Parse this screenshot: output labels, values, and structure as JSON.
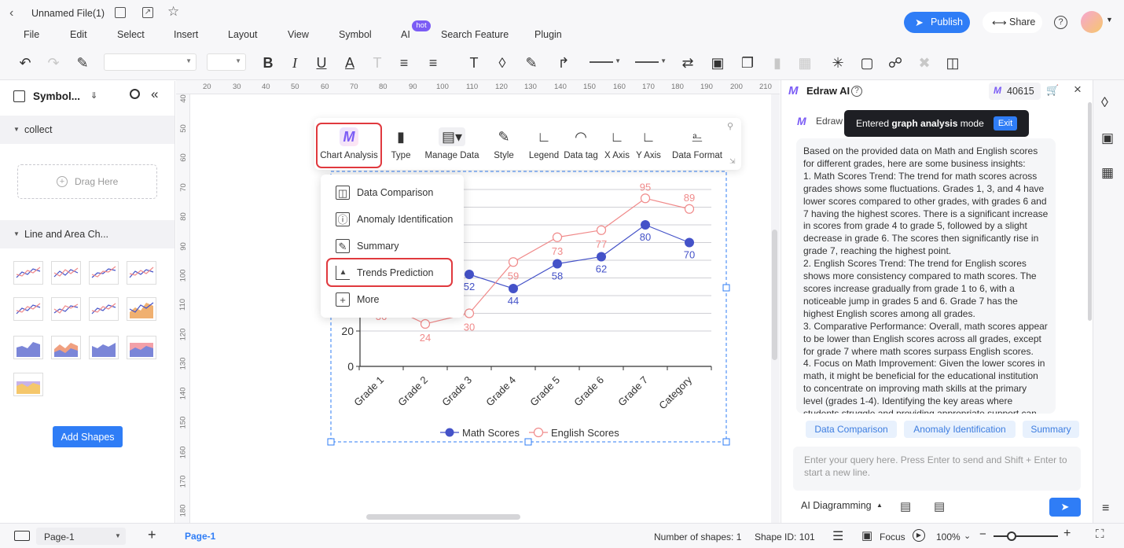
{
  "titlebar": {
    "file_name": "Unnamed File(1)",
    "publish_label": "Publish",
    "share_label": "Share"
  },
  "menu": {
    "items": [
      "File",
      "Edit",
      "Select",
      "Insert",
      "Layout",
      "View",
      "Symbol",
      "AI",
      "Search Feature",
      "Plugin"
    ],
    "ai_badge": "hot"
  },
  "left_panel": {
    "title": "Symbol...",
    "collect_label": "collect",
    "drag_here": "Drag Here",
    "library_label": "Line and Area Ch...",
    "add_shapes_label": "Add Shapes"
  },
  "rulers": {
    "h_ticks": [
      "20",
      "30",
      "40",
      "50",
      "60",
      "70",
      "80",
      "90",
      "100",
      "110",
      "120",
      "130",
      "140",
      "150",
      "160",
      "170",
      "180",
      "190",
      "200",
      "210"
    ],
    "v_ticks": [
      "40",
      "50",
      "60",
      "70",
      "80",
      "90",
      "100",
      "110",
      "120",
      "130",
      "140",
      "150",
      "160",
      "170",
      "180"
    ]
  },
  "chart_toolbar": {
    "items": [
      "Chart Analysis",
      "Type",
      "Manage Data",
      "Style",
      "Legend",
      "Data tag",
      "X Axis",
      "Y Axis",
      "Data Format"
    ]
  },
  "dropdown": {
    "items": [
      "Data Comparison",
      "Anomaly Identification",
      "Summary",
      "Trends Prediction",
      "More"
    ]
  },
  "chart_data": {
    "type": "line",
    "categories": [
      "Grade 1",
      "Grade 2",
      "Grade 3",
      "Grade 4",
      "Grade 5",
      "Grade 6",
      "Grade 7",
      "Category"
    ],
    "series": [
      {
        "name": "Math Scores",
        "color": "#4452c8",
        "values": [
          null,
          null,
          52,
          44,
          58,
          62,
          80,
          70
        ]
      },
      {
        "name": "English Scores",
        "color": "#f08a8a",
        "values": [
          36,
          24,
          30,
          59,
          73,
          77,
          95,
          89
        ]
      }
    ],
    "y_ticks": [
      "0",
      "20"
    ],
    "ylim": [
      0,
      100
    ],
    "legend_position": "bottom",
    "grid": true
  },
  "ai_panel": {
    "title": "Edraw AI",
    "credits": "40615",
    "sender": "Edraw",
    "toast_prefix": "Entered ",
    "toast_bold": "graph analysis",
    "toast_suffix": " mode",
    "toast_exit": "Exit",
    "message": "Based on the provided data on Math and English scores for different grades, here are some business insights:\n1. Math Scores Trend: The trend for math scores across grades shows some fluctuations. Grades 1, 3, and 4 have lower scores compared to other grades, with grades 6 and 7 having the highest scores. There is a significant increase in scores from grade 4 to grade 5, followed by a slight decrease in grade 6. The scores then significantly rise in grade 7, reaching the highest point.\n2. English Scores Trend: The trend for English scores shows more consistency compared to math scores. The scores increase gradually from grade 1 to 6, with a noticeable jump in grades 5 and 6. Grade 7 has the highest English scores among all grades.\n3. Comparative Performance: Overall, math scores appear to be lower than English scores across all grades, except for grade 7 where math scores surpass English scores.\n4. Focus on Math Improvement: Given the lower scores in math, it might be beneficial for the educational institution to concentrate on improving math skills at the primary level (grades 1-4). Identifying the key areas where students struggle and providing appropriate support can",
    "chips": [
      "Data Comparison",
      "Anomaly Identification",
      "Summary"
    ],
    "input_placeholder": "Enter your query here. Press Enter to send and Shift + Enter to start a new line.",
    "mode_label": "AI Diagramming"
  },
  "statusbar": {
    "page_select": "Page-1",
    "page_tab": "Page-1",
    "shape_count": "Number of shapes: 1",
    "shape_id": "Shape ID: 101",
    "focus_label": "Focus",
    "zoom": "100%"
  },
  "colors": {
    "accent": "#2f7df6",
    "math": "#4452c8",
    "english": "#f08a8a",
    "highlight": "#e0393e"
  }
}
